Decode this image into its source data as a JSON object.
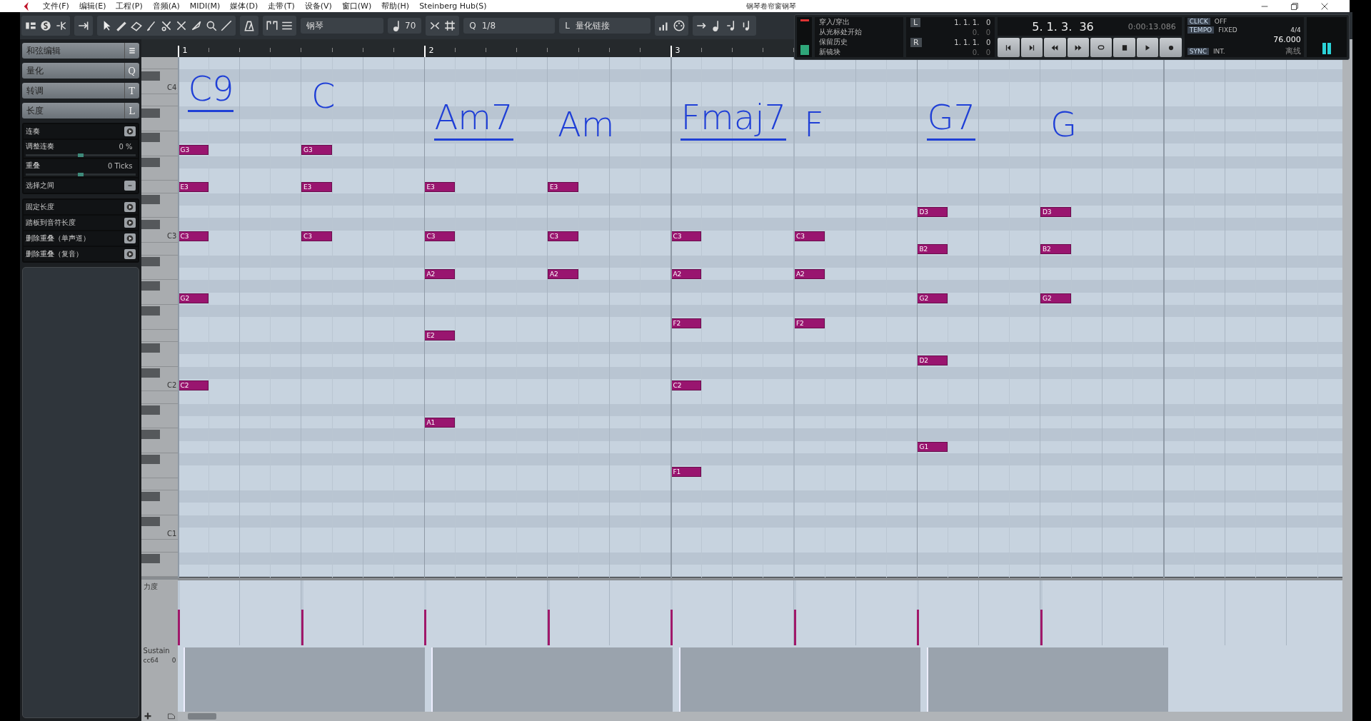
{
  "menu_bar": {
    "items": [
      "文件(F)",
      "编辑(E)",
      "工程(P)",
      "音频(A)",
      "MIDI(M)",
      "媒体(D)",
      "走带(T)",
      "设备(V)",
      "窗口(W)",
      "帮助(H)",
      "Steinberg Hub(S)"
    ],
    "title": "钢琴卷帘窗钢琴"
  },
  "toolbar": {
    "instrument": "钢琴",
    "velocity": "70",
    "quantize_label": "Q",
    "quantize": "1/8",
    "length_label": "L",
    "length": "量化链接"
  },
  "transport": {
    "punch": "穿入/穿出",
    "start_from_cursor": "从光标处开始",
    "keep_history": "保留历史",
    "new_take": "新镜块",
    "locators": [
      {
        "label": "L",
        "position": "1. 1. 1.   0",
        "offset": "0.   0"
      },
      {
        "label": "R",
        "position": "1. 1. 1.   0",
        "offset": "0.   0"
      }
    ],
    "position": "5. 1. 3.  36",
    "time": "0:00:13.086",
    "click": {
      "label": "CLICK",
      "value": "OFF"
    },
    "tempo": {
      "label": "TEMPO",
      "value": "FIXED",
      "signature": "4/4",
      "bpm": "76.000"
    },
    "sync": {
      "label": "SYNC",
      "value": "INT.",
      "status": "离线"
    }
  },
  "inspector": {
    "sections": [
      {
        "title": "和弦编辑",
        "kind": "icon"
      },
      {
        "title": "量化",
        "kind": "key",
        "key": "Q"
      },
      {
        "title": "转调",
        "kind": "key",
        "key": "T"
      },
      {
        "title": "长度",
        "kind": "key",
        "key": "L"
      }
    ],
    "length_tools": [
      {
        "label": "连奏",
        "kind": "action"
      },
      {
        "label": "调整连奏",
        "kind": "slider",
        "value": "0 %",
        "level": 0.5
      },
      {
        "label": "重叠",
        "kind": "slider",
        "value": "0 Ticks",
        "level": 0.5
      },
      {
        "label": "选择之间",
        "kind": "toggle"
      }
    ],
    "length_actions": [
      {
        "label": "固定长度"
      },
      {
        "label": "踏板到音符长度"
      },
      {
        "label": "删除重叠（单声道）"
      },
      {
        "label": "删除重叠（复音）"
      }
    ]
  },
  "ruler": {
    "bars": [
      "1",
      "2",
      "3"
    ]
  },
  "key_rows": [
    {
      "kind": "white"
    },
    {
      "kind": "black"
    },
    {
      "kind": "white",
      "key_label": "C4"
    },
    {
      "kind": "white"
    },
    {
      "kind": "black"
    },
    {
      "kind": "white"
    },
    {
      "kind": "black"
    },
    {
      "kind": "white",
      "slots": [
        {
          "kind": "note",
          "label": "G3"
        },
        {
          "kind": "note",
          "label": "G3"
        },
        {
          "kind": "empty"
        },
        {
          "kind": "empty"
        },
        {
          "kind": "empty"
        },
        {
          "kind": "empty"
        },
        {
          "kind": "empty"
        },
        {
          "kind": "empty"
        }
      ]
    },
    {
      "kind": "black"
    },
    {
      "kind": "white"
    },
    {
      "kind": "white",
      "slots": [
        {
          "kind": "note",
          "label": "E3"
        },
        {
          "kind": "note",
          "label": "E3"
        },
        {
          "kind": "note",
          "label": "E3"
        },
        {
          "kind": "note",
          "label": "E3"
        },
        {
          "kind": "empty"
        },
        {
          "kind": "empty"
        },
        {
          "kind": "empty"
        },
        {
          "kind": "empty"
        }
      ]
    },
    {
      "kind": "black"
    },
    {
      "kind": "white",
      "slots": [
        {
          "kind": "empty"
        },
        {
          "kind": "empty"
        },
        {
          "kind": "empty"
        },
        {
          "kind": "empty"
        },
        {
          "kind": "empty"
        },
        {
          "kind": "empty"
        },
        {
          "kind": "note",
          "label": "D3"
        },
        {
          "kind": "note",
          "label": "D3"
        }
      ]
    },
    {
      "kind": "black"
    },
    {
      "kind": "white",
      "key_label": "C3",
      "slots": [
        {
          "kind": "note",
          "label": "C3"
        },
        {
          "kind": "note",
          "label": "C3"
        },
        {
          "kind": "note",
          "label": "C3"
        },
        {
          "kind": "note",
          "label": "C3"
        },
        {
          "kind": "note",
          "label": "C3"
        },
        {
          "kind": "note",
          "label": "C3"
        },
        {
          "kind": "empty"
        },
        {
          "kind": "empty"
        }
      ]
    },
    {
      "kind": "white",
      "slots": [
        {
          "kind": "empty"
        },
        {
          "kind": "empty"
        },
        {
          "kind": "empty"
        },
        {
          "kind": "empty"
        },
        {
          "kind": "empty"
        },
        {
          "kind": "empty"
        },
        {
          "kind": "note",
          "label": "B2"
        },
        {
          "kind": "note",
          "label": "B2"
        }
      ]
    },
    {
      "kind": "black"
    },
    {
      "kind": "white",
      "slots": [
        {
          "kind": "empty"
        },
        {
          "kind": "empty"
        },
        {
          "kind": "note",
          "label": "A2"
        },
        {
          "kind": "note",
          "label": "A2"
        },
        {
          "kind": "note",
          "label": "A2"
        },
        {
          "kind": "note",
          "label": "A2"
        },
        {
          "kind": "empty"
        },
        {
          "kind": "empty"
        }
      ]
    },
    {
      "kind": "black"
    },
    {
      "kind": "white",
      "slots": [
        {
          "kind": "note",
          "label": "G2"
        },
        {
          "kind": "empty"
        },
        {
          "kind": "empty"
        },
        {
          "kind": "empty"
        },
        {
          "kind": "empty"
        },
        {
          "kind": "empty"
        },
        {
          "kind": "note",
          "label": "G2"
        },
        {
          "kind": "note",
          "label": "G2"
        }
      ]
    },
    {
      "kind": "black"
    },
    {
      "kind": "white",
      "slots": [
        {
          "kind": "empty"
        },
        {
          "kind": "empty"
        },
        {
          "kind": "empty"
        },
        {
          "kind": "empty"
        },
        {
          "kind": "note",
          "label": "F2"
        },
        {
          "kind": "note",
          "label": "F2"
        },
        {
          "kind": "empty"
        },
        {
          "kind": "empty"
        }
      ]
    },
    {
      "kind": "white",
      "slots": [
        {
          "kind": "empty"
        },
        {
          "kind": "empty"
        },
        {
          "kind": "note",
          "label": "E2"
        },
        {
          "kind": "empty"
        },
        {
          "kind": "empty"
        },
        {
          "kind": "empty"
        },
        {
          "kind": "empty"
        },
        {
          "kind": "empty"
        }
      ]
    },
    {
      "kind": "black"
    },
    {
      "kind": "white",
      "slots": [
        {
          "kind": "empty"
        },
        {
          "kind": "empty"
        },
        {
          "kind": "empty"
        },
        {
          "kind": "empty"
        },
        {
          "kind": "empty"
        },
        {
          "kind": "empty"
        },
        {
          "kind": "note",
          "label": "D2"
        },
        {
          "kind": "empty"
        }
      ]
    },
    {
      "kind": "black"
    },
    {
      "kind": "white",
      "key_label": "C2",
      "slots": [
        {
          "kind": "note",
          "label": "C2"
        },
        {
          "kind": "empty"
        },
        {
          "kind": "empty"
        },
        {
          "kind": "empty"
        },
        {
          "kind": "note",
          "label": "C2"
        },
        {
          "kind": "empty"
        },
        {
          "kind": "empty"
        },
        {
          "kind": "empty"
        }
      ]
    },
    {
      "kind": "white"
    },
    {
      "kind": "black"
    },
    {
      "kind": "white",
      "slots": [
        {
          "kind": "empty"
        },
        {
          "kind": "empty"
        },
        {
          "kind": "note",
          "label": "A1"
        },
        {
          "kind": "empty"
        },
        {
          "kind": "empty"
        },
        {
          "kind": "empty"
        },
        {
          "kind": "empty"
        },
        {
          "kind": "empty"
        }
      ]
    },
    {
      "kind": "black"
    },
    {
      "kind": "white",
      "slots": [
        {
          "kind": "empty"
        },
        {
          "kind": "empty"
        },
        {
          "kind": "empty"
        },
        {
          "kind": "empty"
        },
        {
          "kind": "empty"
        },
        {
          "kind": "empty"
        },
        {
          "kind": "note",
          "label": "G1"
        },
        {
          "kind": "empty"
        }
      ]
    },
    {
      "kind": "black"
    },
    {
      "kind": "white",
      "slots": [
        {
          "kind": "empty"
        },
        {
          "kind": "empty"
        },
        {
          "kind": "empty"
        },
        {
          "kind": "empty"
        },
        {
          "kind": "note",
          "label": "F1"
        },
        {
          "kind": "empty"
        },
        {
          "kind": "empty"
        },
        {
          "kind": "empty"
        }
      ]
    },
    {
      "kind": "white"
    },
    {
      "kind": "black"
    },
    {
      "kind": "white"
    },
    {
      "kind": "black"
    },
    {
      "kind": "white",
      "key_label": "C1"
    },
    {
      "kind": "white"
    },
    {
      "kind": "black"
    },
    {
      "kind": "white"
    }
  ],
  "ink_annotations": [
    {
      "text": "C9",
      "underlined": true
    },
    {
      "text": "C",
      "underlined": false
    },
    {
      "text": "Am7",
      "underlined": true
    },
    {
      "text": "Am",
      "underlined": false
    },
    {
      "text": "Fmaj7",
      "underlined": true
    },
    {
      "text": "F",
      "underlined": false
    },
    {
      "text": "G7",
      "underlined": true
    },
    {
      "text": "G",
      "underlined": false
    }
  ],
  "velocity_lane": {
    "label": "力度",
    "hits": [
      {
        "level": 0.55
      },
      {
        "level": 0.55
      },
      {
        "level": 0.55
      },
      {
        "level": 0.55
      },
      {
        "level": 0.55
      },
      {
        "level": 0.55
      },
      {
        "level": 0.55
      },
      {
        "level": 0.55
      }
    ]
  },
  "sustain_lane": {
    "label": "Sustain",
    "controller": "cc64",
    "value": "0"
  }
}
